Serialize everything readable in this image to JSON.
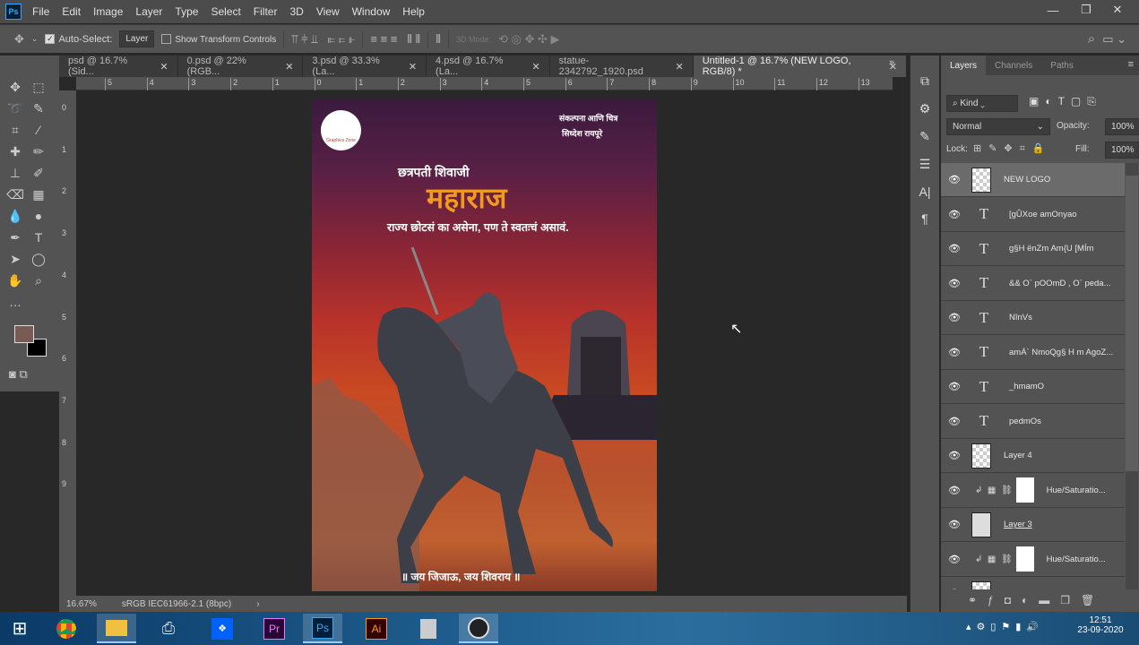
{
  "app": {
    "logo": "Ps",
    "menu": [
      "File",
      "Edit",
      "Image",
      "Layer",
      "Type",
      "Select",
      "Filter",
      "3D",
      "View",
      "Window",
      "Help"
    ]
  },
  "options": {
    "auto_select": "Auto-Select:",
    "auto_select_checked": true,
    "target": "Layer",
    "show_transform": "Show Transform Controls",
    "mode_3d": "3D Mode:"
  },
  "tabs": [
    {
      "label": "psd @ 16.7% (Sid...",
      "active": false
    },
    {
      "label": "0.psd @ 22% (RGB...",
      "active": false
    },
    {
      "label": "3.psd @ 33.3% (La...",
      "active": false
    },
    {
      "label": "4.psd @ 16.7% (La...",
      "active": false
    },
    {
      "label": "statue-2342792_1920.psd",
      "active": false
    },
    {
      "label": "Untitled-1 @ 16.7% (NEW LOGO, RGB/8) *",
      "active": true
    }
  ],
  "ruler": [
    "5",
    "4",
    "3",
    "2",
    "1",
    "0",
    "1",
    "2",
    "3",
    "4",
    "5",
    "6",
    "7",
    "8",
    "9",
    "10",
    "11",
    "12",
    "13"
  ],
  "vruler": [
    "0",
    "1",
    "2",
    "3",
    "4",
    "5",
    "6",
    "7",
    "8",
    "9"
  ],
  "poster": {
    "credit1": "संकल्पना आणि चित्र",
    "credit2": "सिध्देश रायपूरे",
    "logo_text": "Graphics Zone",
    "line1": "छत्रपती शिवाजी",
    "title": "महाराज",
    "tagline": "राज्य छोटसं का असेना, पण ते स्वतःचं असावं.",
    "footer": "॥ जय जिजाऊ, जय शिवराय ॥"
  },
  "status": {
    "zoom": "16.67%",
    "profile": "sRGB IEC61966-2.1 (8bpc)"
  },
  "panel": {
    "tabs": [
      "Layers",
      "Channels",
      "Paths"
    ],
    "filter": "Kind",
    "blend": "Normal",
    "opacity_label": "Opacity:",
    "opacity": "100%",
    "lock_label": "Lock:",
    "fill_label": "Fill:",
    "fill": "100%",
    "layers": [
      {
        "name": "NEW LOGO",
        "type": "smart",
        "selected": true
      },
      {
        "name": "[gÛXoe amOnyao",
        "type": "text"
      },
      {
        "name": "g§H ënZm Am{U [MÍm",
        "type": "text"
      },
      {
        "name": "&&  O` pOOmD , O` peda...",
        "type": "text"
      },
      {
        "name": "NînVs",
        "type": "text"
      },
      {
        "name": "amÁ` NmoQg§ H m AgoZ...",
        "type": "text"
      },
      {
        "name": "_hmamO",
        "type": "text"
      },
      {
        "name": "pedmOs",
        "type": "text"
      },
      {
        "name": "Layer 4",
        "type": "pixel"
      },
      {
        "name": "Hue/Saturatio...",
        "type": "adjust"
      },
      {
        "name": "Layer 3",
        "type": "image"
      },
      {
        "name": "Hue/Saturatio...",
        "type": "adjust"
      },
      {
        "name": "",
        "type": "pixel"
      }
    ]
  },
  "taskbar": {
    "time": "12:51",
    "date": "23-09-2020"
  }
}
